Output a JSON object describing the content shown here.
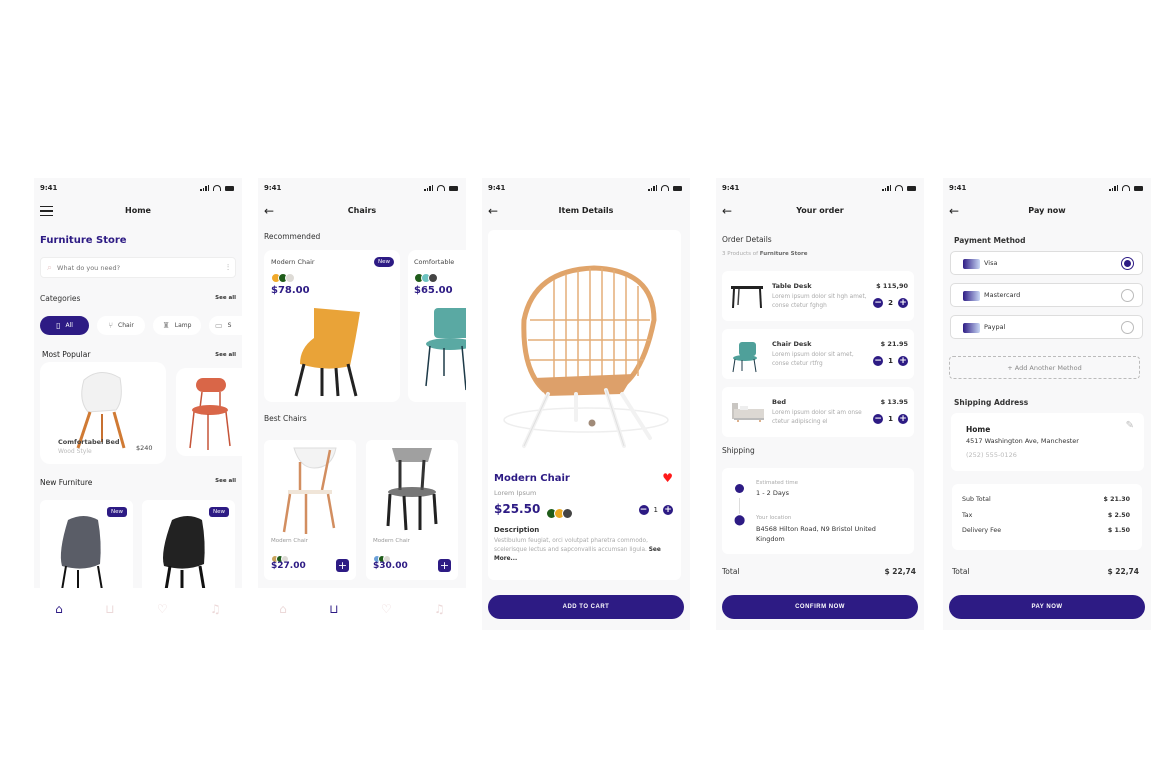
{
  "colors": {
    "primary": "#2d1b84",
    "heart": "#ff1a1a",
    "nav_inactive": "#ecd9d9"
  },
  "status_time": "9:41",
  "home": {
    "title": "Home",
    "brand": "Furniture Store",
    "search_placeholder": "What do you need?",
    "categories_label": "Categories",
    "see_all": "See all",
    "categories": [
      {
        "label": "All",
        "icon": "cabinet-icon",
        "active": true
      },
      {
        "label": "Chair",
        "icon": "armchair-icon",
        "active": false
      },
      {
        "label": "Lamp",
        "icon": "lamp-icon",
        "active": false
      },
      {
        "label": "S",
        "icon": "sofa-icon",
        "active": false
      }
    ],
    "most_popular_label": "Most Popular",
    "popular": [
      {
        "name": "Comfortabel Bed",
        "subtitle": "Wood Style",
        "price": "$240"
      },
      {
        "name": "",
        "subtitle": "",
        "price": ""
      }
    ],
    "new_furniture_label": "New Furniture",
    "new_items": [
      {
        "badge": "New"
      },
      {
        "badge": "New"
      }
    ],
    "nav": [
      "home-icon",
      "bag-icon",
      "heart-icon",
      "bell-icon"
    ]
  },
  "chairs": {
    "title": "Chairs",
    "recommended_label": "Recommended",
    "recommended": [
      {
        "name": "Modern Chair",
        "badge": "New",
        "price": "$78.00",
        "swatches": [
          "#f0a92a",
          "#1f5c1a",
          "#dedbd6"
        ]
      },
      {
        "name": "Comfortable",
        "badge": "",
        "price": "$65.00",
        "swatches": [
          "#1f5c1a",
          "#6cc2c0",
          "#444444"
        ]
      }
    ],
    "best_label": "Best Chairs",
    "best": [
      {
        "name": "Modern Chair",
        "price": "$27.00",
        "swatches": [
          "#c9a25c",
          "#1f5c1a",
          "#dedbd6"
        ]
      },
      {
        "name": "Modern Chair",
        "price": "$30.00",
        "swatches": [
          "#6a9fd8",
          "#1f5c1a",
          "#dedbd6"
        ]
      }
    ]
  },
  "item": {
    "title": "Item Details",
    "name": "Modern Chair",
    "subtitle": "Lorem Ipsum",
    "price": "$25.50",
    "swatches": [
      "#1f5c1a",
      "#e8a822",
      "#444444"
    ],
    "quantity": "1",
    "favorite": true,
    "description_label": "Description",
    "description": "Vestibulum feugiat, orci volutpat pharetra commodo, scelerisque lectus and sapconvallis accumsan ligula.",
    "see_more": "See More...",
    "cta": "ADD TO CART"
  },
  "order": {
    "title": "Your order",
    "details_label": "Order Details",
    "details_sub_prefix": "3 Products of ",
    "details_sub_store": "Furniture Store",
    "items": [
      {
        "name": "Table Desk",
        "desc": "Lorem ipsum dolor sit hgh amet, conse ctetur fghgh",
        "price": "$ 115,90",
        "qty": "2"
      },
      {
        "name": "Chair Desk",
        "desc": "Lorem ipsum dolor sit amet, conse ctetur  rtfrg",
        "price": "$ 21.95",
        "qty": "1"
      },
      {
        "name": "Bed",
        "desc": "Lorem ipsum dolor sit am onse ctetur adipiscing el",
        "price": "$ 13.95",
        "qty": "1"
      }
    ],
    "shipping_label": "Shipping",
    "est_label": "Estimated time",
    "est_value": "1 - 2 Days",
    "loc_label": "Your location",
    "loc_value": "B4568 Hilton Road, N9 Bristol United Kingdom",
    "total_label": "Total",
    "total": "$ 22,74",
    "cta": "CONFIRM NOW"
  },
  "pay": {
    "title": "Pay now",
    "method_label": "Payment Method",
    "methods": [
      {
        "label": "Visa",
        "selected": true
      },
      {
        "label": "Mastercard",
        "selected": false
      },
      {
        "label": "Paypal",
        "selected": false
      }
    ],
    "add_method": "+ Add Another Method",
    "address_label": "Shipping Address",
    "address_name": "Home",
    "address_line": "4517 Washington Ave, Manchester",
    "address_phone": "(252) 555-0126",
    "summary": [
      {
        "label": "Sub Total",
        "value": "$ 21.30"
      },
      {
        "label": "Tax",
        "value": "$ 2.50"
      },
      {
        "label": "Delivery Fee",
        "value": "$ 1.50"
      }
    ],
    "total_label": "Total",
    "total": "$ 22,74",
    "cta": "PAY NOW"
  }
}
